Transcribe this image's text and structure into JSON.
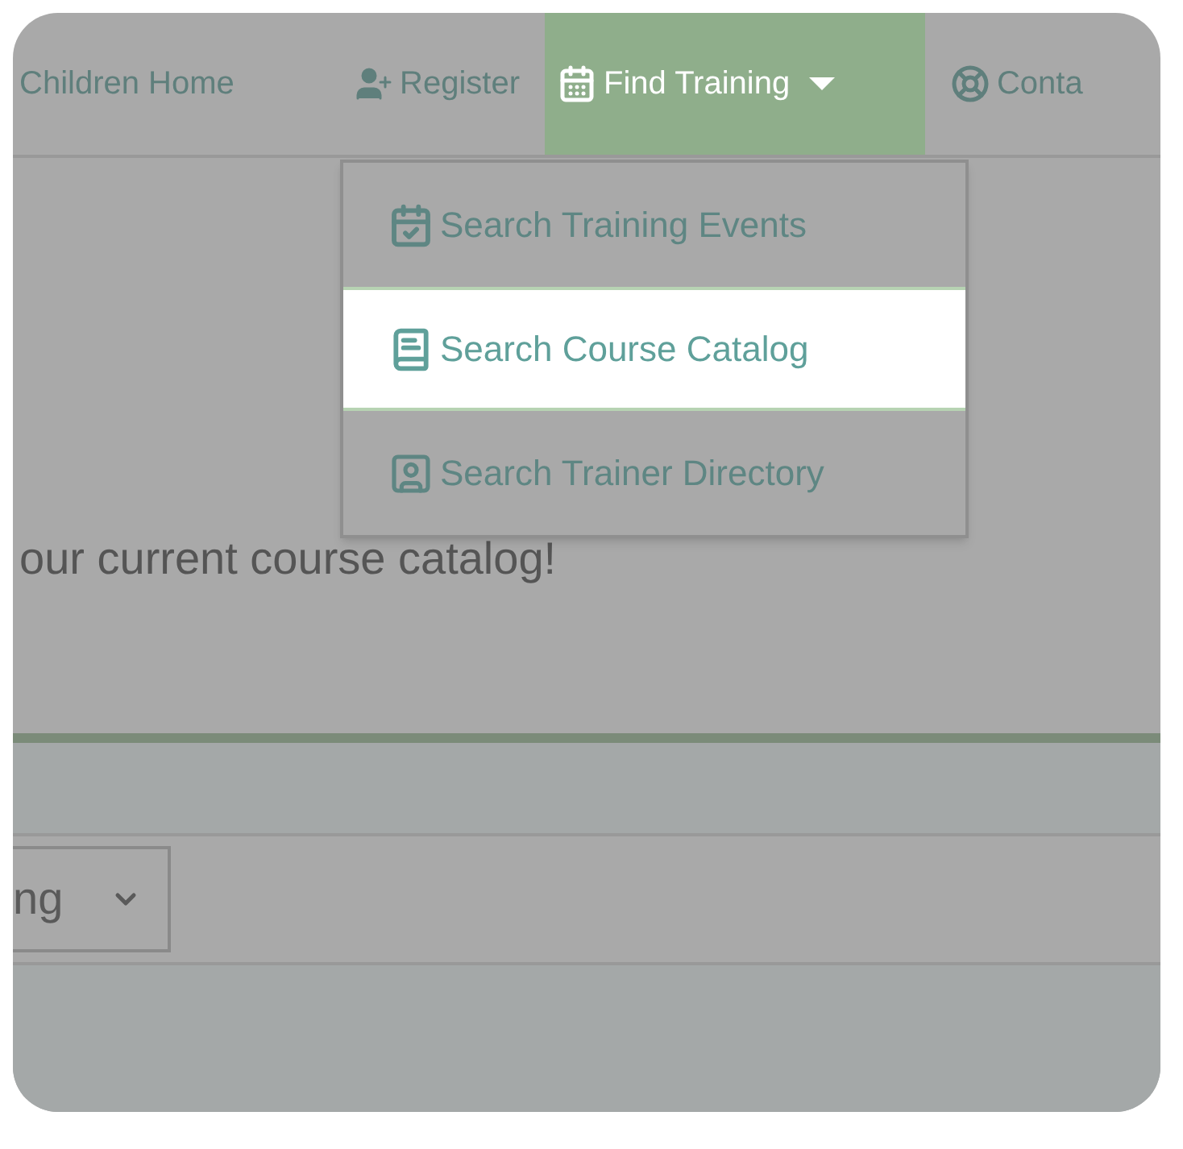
{
  "nav": {
    "items": [
      {
        "label": "Children Home",
        "kind": "plain",
        "selected": false
      },
      {
        "label": "Register",
        "kind": "register",
        "selected": false
      },
      {
        "label": "Find Training",
        "kind": "training",
        "selected": true
      },
      {
        "label": "Conta",
        "kind": "contact",
        "selected": false
      }
    ]
  },
  "dropdown": {
    "items": [
      {
        "label": "Search Training Events",
        "kind": "events",
        "selected": false
      },
      {
        "label": "Search Course Catalog",
        "kind": "catalog",
        "selected": true
      },
      {
        "label": "Search Trainer Directory",
        "kind": "directory",
        "selected": false
      }
    ]
  },
  "intro": "our current course catalog!",
  "sort_select": {
    "value": "ng"
  }
}
